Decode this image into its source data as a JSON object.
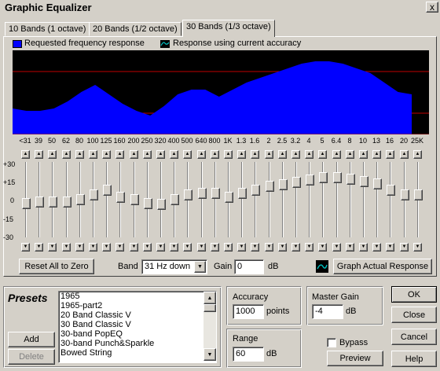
{
  "window": {
    "title": "Graphic Equalizer",
    "close_glyph": "x"
  },
  "tabs": [
    {
      "label": "10 Bands (1 octave)",
      "active": false
    },
    {
      "label": "20 Bands (1/2 octave)",
      "active": false
    },
    {
      "label": "30 Bands (1/3 octave)",
      "active": true
    }
  ],
  "legend": {
    "requested": "Requested frequency response",
    "current": "Response using current accuracy",
    "requested_color": "#0000ff",
    "grid_color": "#c00000"
  },
  "db_labels": [
    "+30",
    "+15",
    "0",
    "-15",
    "-30"
  ],
  "bands": [
    {
      "label": "<31",
      "gain": -3
    },
    {
      "label": "39",
      "gain": -2
    },
    {
      "label": "50",
      "gain": -2
    },
    {
      "label": "62",
      "gain": -2
    },
    {
      "label": "80",
      "gain": 0
    },
    {
      "label": "100",
      "gain": 4
    },
    {
      "label": "125",
      "gain": 8
    },
    {
      "label": "160",
      "gain": 2
    },
    {
      "label": "200",
      "gain": 0
    },
    {
      "label": "250",
      "gain": -3
    },
    {
      "label": "320",
      "gain": -4
    },
    {
      "label": "400",
      "gain": 0
    },
    {
      "label": "500",
      "gain": 4
    },
    {
      "label": "640",
      "gain": 5
    },
    {
      "label": "800",
      "gain": 5
    },
    {
      "label": "1K",
      "gain": 2
    },
    {
      "label": "1.3",
      "gain": 5
    },
    {
      "label": "1.6",
      "gain": 8
    },
    {
      "label": "2",
      "gain": 11
    },
    {
      "label": "2.5",
      "gain": 12
    },
    {
      "label": "3.2",
      "gain": 14
    },
    {
      "label": "4",
      "gain": 16
    },
    {
      "label": "5",
      "gain": 18
    },
    {
      "label": "6.4",
      "gain": 18
    },
    {
      "label": "8",
      "gain": 17
    },
    {
      "label": "10",
      "gain": 15
    },
    {
      "label": "13",
      "gain": 13
    },
    {
      "label": "16",
      "gain": 8
    },
    {
      "label": "20",
      "gain": 4
    },
    {
      "label": "25K",
      "gain": 4
    }
  ],
  "response_curve": [
    -4,
    -5,
    -5,
    -4,
    -1,
    3,
    6,
    2,
    -2,
    -5,
    -7,
    -3,
    2,
    4,
    4,
    1,
    4,
    7,
    9,
    11,
    13,
    15,
    16,
    16,
    15,
    13,
    11,
    7,
    3,
    2
  ],
  "controls": {
    "reset_label": "Reset All to Zero",
    "band_label": "Band",
    "band_value": "31 Hz down",
    "gain_label": "Gain",
    "gain_value": "0",
    "gain_unit": "dB",
    "graph_actual_label": "Graph Actual Response"
  },
  "presets": {
    "heading": "Presets",
    "items": [
      "1965",
      "1965-part2",
      "20 Band Classic V",
      "30 Band Classic V",
      "30-band PopEQ",
      "30-band Punch&Sparkle",
      "Bowed String"
    ],
    "add_label": "Add",
    "delete_label": "Delete"
  },
  "accuracy": {
    "label": "Accuracy",
    "value": "1000",
    "unit": "points"
  },
  "range": {
    "label": "Range",
    "value": "60",
    "unit": "dB"
  },
  "master_gain": {
    "label": "Master Gain",
    "value": "-4",
    "unit": "dB"
  },
  "bypass": {
    "label": "Bypass",
    "checked": false
  },
  "buttons": {
    "ok": "OK",
    "close": "Close",
    "cancel": "Cancel",
    "preview": "Preview",
    "help": "Help"
  }
}
